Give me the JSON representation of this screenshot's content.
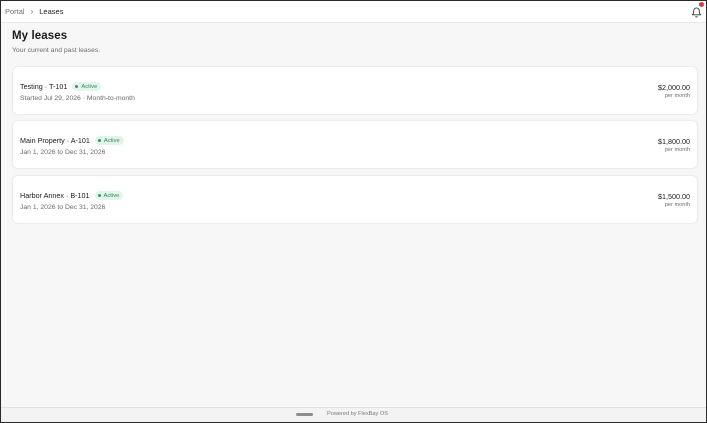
{
  "breadcrumb": {
    "parent": "Portal",
    "separator": "›",
    "current": "Leases"
  },
  "header": {
    "title": "My leases",
    "subtitle": "Your current and past leases."
  },
  "leases": [
    {
      "title": "Testing · T-101",
      "status": "Active",
      "dates": "Started Jul 29, 2026 · Month-to-month",
      "amount": "$2,000.00",
      "period": "per month"
    },
    {
      "title": "Main Property · A-101",
      "status": "Active",
      "dates": "Jan 1, 2026 to Dec 31, 2026",
      "amount": "$1,800.00",
      "period": "per month"
    },
    {
      "title": "Harbor Annex · B-101",
      "status": "Active",
      "dates": "Jan 1, 2026 to Dec 31, 2026",
      "amount": "$1,500.00",
      "period": "per month"
    }
  ],
  "footer": {
    "powered_by": "Powered by FlexBay OS"
  },
  "colors": {
    "badge_bg": "#e3f5ea",
    "badge_text": "#2e8a55",
    "notification_dot": "#d93b3b"
  },
  "icons": {
    "bell": "bell-icon",
    "chevron": "chevron-right-icon"
  }
}
